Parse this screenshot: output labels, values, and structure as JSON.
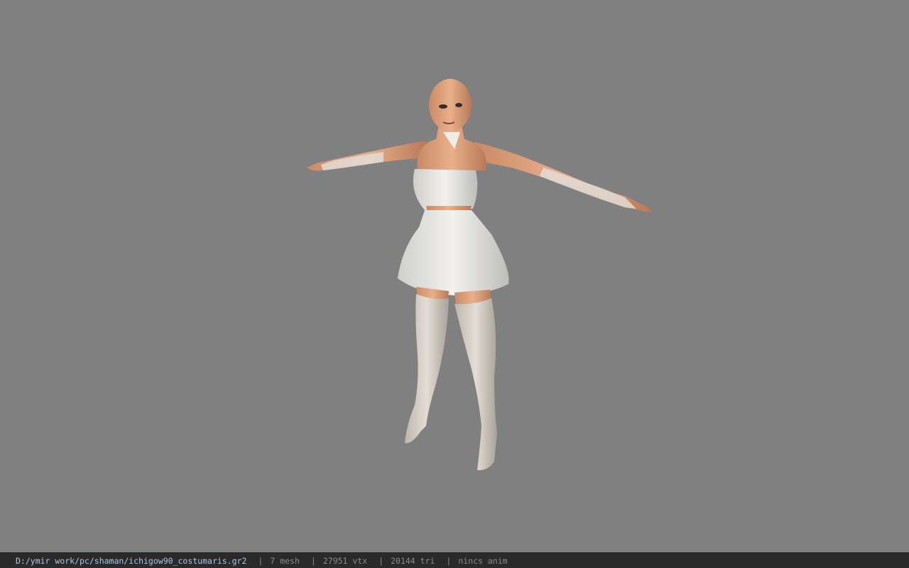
{
  "viewport": {
    "background_color": "#808080"
  },
  "status_bar": {
    "file_path": "D:/ymir work/pc/shaman/ichigow90_costumaris.gr2",
    "separator": "|",
    "mesh": "7 mesh",
    "vertices": "27951 vtx",
    "triangles": "20144 tri",
    "animation": "nincs anim",
    "path_color": "#a9c8e0",
    "text_color": "#8a8a8a"
  }
}
